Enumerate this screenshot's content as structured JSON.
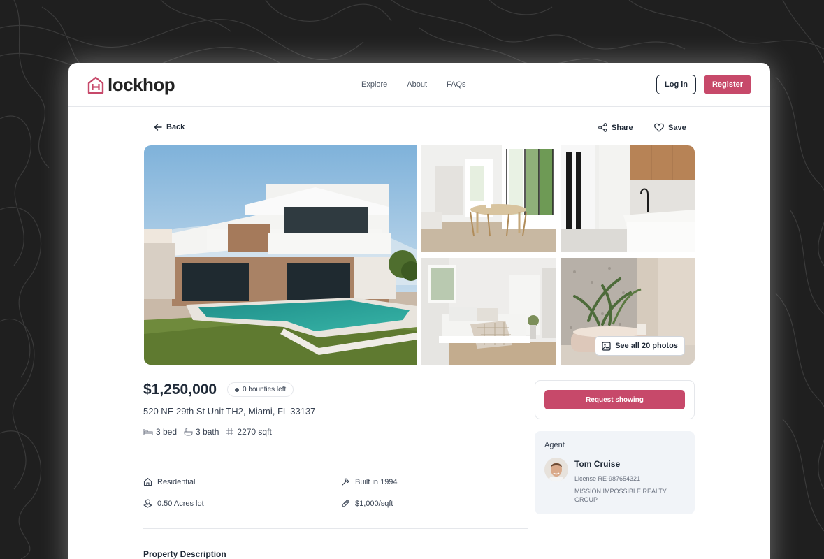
{
  "brand": {
    "name": "lockhop",
    "accent": "#c7496a"
  },
  "nav": {
    "links": [
      "Explore",
      "About",
      "FAQs"
    ],
    "login_label": "Log in",
    "register_label": "Register"
  },
  "toolbar": {
    "back_label": "Back",
    "share_label": "Share",
    "save_label": "Save"
  },
  "gallery": {
    "see_all_label": "See all 20 photos"
  },
  "listing": {
    "price": "$1,250,000",
    "bounties": "0 bounties left",
    "address": "520 NE 29th St Unit TH2, Miami, FL 33137",
    "beds": "3 bed",
    "baths": "3 bath",
    "sqft": "2270 sqft",
    "features": {
      "type": "Residential",
      "built": "Built in 1994",
      "lot": "0.50 Acres lot",
      "price_per_sqft": "$1,000/sqft"
    },
    "description_title": "Property Description"
  },
  "cta": {
    "request_label": "Request showing"
  },
  "agent": {
    "section_label": "Agent",
    "name": "Tom Cruise",
    "license": "License RE-987654321",
    "company": "MISSION IMPOSSIBLE REALTY GROUP"
  }
}
